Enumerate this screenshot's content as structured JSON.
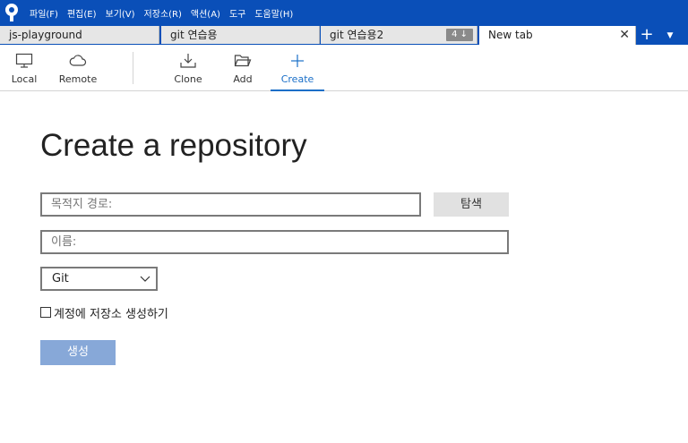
{
  "menubar": {
    "items": [
      "파일(F)",
      "편집(E)",
      "보기(V)",
      "저장소(R)",
      "액션(A)",
      "도구",
      "도움말(H)"
    ]
  },
  "tabs": [
    {
      "label": "js-playground"
    },
    {
      "label": "git 연습용"
    },
    {
      "label": "git 연습용2",
      "badge": "4 ↓"
    },
    {
      "label": "New tab",
      "close": "✕"
    }
  ],
  "tab_actions": {
    "add": "+",
    "dropdown": "▼"
  },
  "toolbar": {
    "items": [
      {
        "label": "Local",
        "icon": "monitor-icon"
      },
      {
        "label": "Remote",
        "icon": "cloud-icon"
      },
      {
        "label": "Clone",
        "icon": "download-icon"
      },
      {
        "label": "Add",
        "icon": "folder-icon"
      },
      {
        "label": "Create",
        "icon": "plus-icon",
        "active": true
      }
    ]
  },
  "main": {
    "title": "Create a repository",
    "destination_placeholder": "목적지 경로:",
    "browse_label": "탐색",
    "name_placeholder": "이름:",
    "vcs_selected": "Git",
    "checkbox_label": "계정에 저장소 생성하기",
    "create_label": "생성"
  },
  "colors": {
    "titlebar": "#0a4fb8",
    "accent": "#1a6fc8",
    "create_button": "#87a8d8"
  }
}
